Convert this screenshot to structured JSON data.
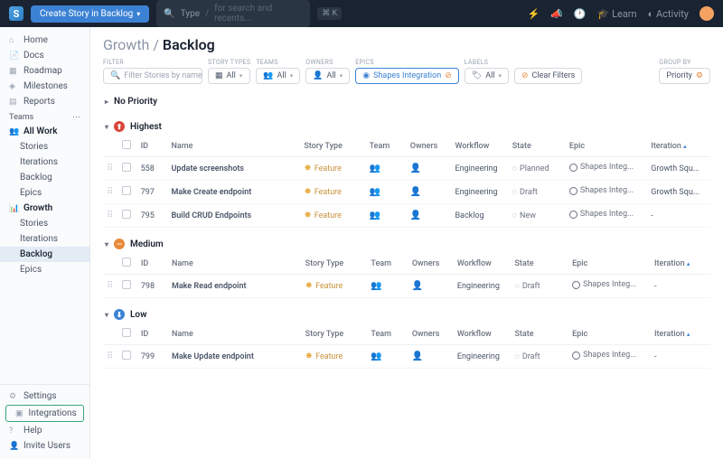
{
  "topbar": {
    "create_label": "Create Story in Backlog",
    "search_prompt": "Type",
    "search_hint": "for search and recents...",
    "kbd": "⌘ K",
    "learn": "Learn",
    "activity": "Activity"
  },
  "sidebar": {
    "home": "Home",
    "docs": "Docs",
    "roadmap": "Roadmap",
    "milestones": "Milestones",
    "reports": "Reports",
    "teams_label": "Teams",
    "all_work": "All Work",
    "stories": "Stories",
    "iterations": "Iterations",
    "backlog": "Backlog",
    "epics": "Epics",
    "growth": "Growth",
    "settings": "Settings",
    "integrations": "Integrations",
    "help": "Help",
    "invite": "Invite Users"
  },
  "breadcrumb": {
    "parent": "Growth",
    "current": "Backlog"
  },
  "filters": {
    "filter_label": "FILTER",
    "filter_placeholder": "Filter Stories by name",
    "story_types_label": "STORY TYPES",
    "teams_label": "TEAMS",
    "owners_label": "OWNERS",
    "epics_label": "EPICS",
    "labels_label": "LABELS",
    "all": "All",
    "epic_value": "Shapes Integration",
    "clear": "Clear Filters",
    "groupby_label": "GROUP BY",
    "groupby_value": "Priority"
  },
  "columns": {
    "id": "ID",
    "name": "Name",
    "story_type": "Story Type",
    "team": "Team",
    "owners": "Owners",
    "workflow": "Workflow",
    "state": "State",
    "epic": "Epic",
    "iteration": "Iteration"
  },
  "groups": [
    {
      "name": "No Priority",
      "icon": "none",
      "rows": []
    },
    {
      "name": "Highest",
      "icon": "highest",
      "rows": [
        {
          "id": "558",
          "name": "Update screenshots",
          "story_type": "Feature",
          "workflow": "Engineering",
          "state": "Planned",
          "epic": "Shapes Integ...",
          "iteration": "Growth Squ..."
        },
        {
          "id": "797",
          "name": "Make Create endpoint",
          "story_type": "Feature",
          "workflow": "Engineering",
          "state": "Draft",
          "epic": "Shapes Integ...",
          "iteration": "Growth Squ..."
        },
        {
          "id": "795",
          "name": "Build CRUD Endpoints",
          "story_type": "Feature",
          "workflow": "Backlog",
          "state": "New",
          "epic": "Shapes Integ...",
          "iteration": "-"
        }
      ]
    },
    {
      "name": "Medium",
      "icon": "medium",
      "rows": [
        {
          "id": "798",
          "name": "Make Read endpoint",
          "story_type": "Feature",
          "workflow": "Engineering",
          "state": "Draft",
          "epic": "Shapes Integ...",
          "iteration": "-"
        }
      ]
    },
    {
      "name": "Low",
      "icon": "low",
      "rows": [
        {
          "id": "799",
          "name": "Make Update endpoint",
          "story_type": "Feature",
          "workflow": "Engineering",
          "state": "Draft",
          "epic": "Shapes Integ...",
          "iteration": "-"
        }
      ]
    }
  ]
}
